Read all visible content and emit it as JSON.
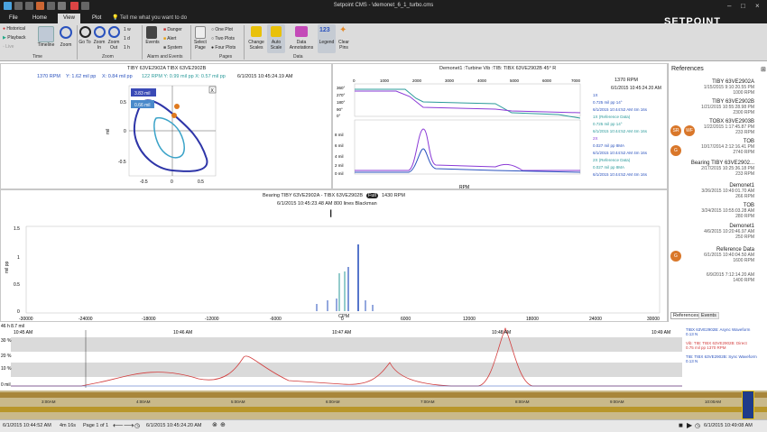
{
  "titlebar": {
    "title": "Setpoint CMS - \\demonet_6_1_turbo.cms"
  },
  "tabs": {
    "file": "File",
    "home": "Home",
    "view": "View",
    "plot": "Plot",
    "tellme": "Tell me what you want to do"
  },
  "brand": "SETPOINT",
  "ribbon": {
    "historical": "Historical",
    "playback": "Playback",
    "live": "Live",
    "timeline": "Timeline",
    "zoom": "Zoom",
    "goto": "Go To",
    "zoom_in": "Zoom In",
    "zoom_out": "Zoom Out",
    "w": "1 w",
    "d": "1 d",
    "h": "1 h",
    "events": "Events",
    "danger": "Danger",
    "alert": "Alert",
    "system": "System",
    "select_page": "Select Page",
    "one_plot": "One Plot",
    "two_plots": "Two Plots",
    "four_plots": "Four Plots",
    "change_scales": "Change Scales",
    "auto_scale": "Auto Scale",
    "data_annotations": "Data Annotations",
    "legend": "Legend",
    "clear_pins": "Clear Pins",
    "grp_time": "Time",
    "grp_zoom": "Zoom",
    "grp_alarm": "Alarm and Events",
    "grp_pages": "Pages",
    "grp_data": "Data"
  },
  "orbit": {
    "title": "TIBY 63VE2902A TIBX 63VE2902B",
    "rpm": "1370 RPM",
    "y": "Y: 1.62 mil pp",
    "x": "X: 0.84 mil pp",
    "readout2": "122 RPM  Y: 0.99 mil pp  X: 0.57 mil pp",
    "time": "6/1/2015 10:45:24.19 AM",
    "tag1": "3.83 mil",
    "tag2": "0.66 mil",
    "ylabel": "mil",
    "yticks": [
      "0.5",
      "0",
      "-0.5"
    ],
    "xticks": [
      "-0.5",
      "0",
      "0.5"
    ],
    "x_marker": "X"
  },
  "bode": {
    "title": "Demonet1 :Turbine Vib :TIB: TIBX 63VE2902B  45° R",
    "rpm": "1370  RPM",
    "time": "6/1/2015 10:45:24.20 AM",
    "xticks": [
      "0",
      "1000",
      "2000",
      "3000",
      "4000",
      "5000",
      "6000",
      "7000"
    ],
    "phase_ticks": [
      "360°",
      "270°",
      "180°",
      "90°",
      "0°"
    ],
    "amp_ticks": [
      "8 mil",
      "6 mil",
      "4 mil",
      "2 mil",
      "0 mil"
    ],
    "xlabel": "RPM",
    "legend": [
      {
        "label": "1X",
        "color": "#2a52be"
      },
      {
        "label": "0.725 mil pp 14°",
        "color": "#2a52be"
      },
      {
        "label": "6/1/2015 10:44:52 AM 4m 16s",
        "color": "#2a52be"
      },
      {
        "label": "1X (Reference Data)",
        "color": "#2a9a9a"
      },
      {
        "label": "0.725 mil pp 14°",
        "color": "#2a9a9a"
      },
      {
        "label": "6/1/2015 10:44:52 AM 4m 16s",
        "color": "#2a9a9a"
      },
      {
        "label": "2X",
        "color": "#8a3ad6"
      },
      {
        "label": "0.027 mil pp 8MA",
        "color": "#2a52be"
      },
      {
        "label": "6/1/2015 10:44:52 AM 4m 16s",
        "color": "#2a52be"
      },
      {
        "label": "2X (Reference Data)",
        "color": "#2a9a9a"
      },
      {
        "label": "0.027 mil pp 8MA",
        "color": "#2a9a9a"
      },
      {
        "label": "6/1/2015 10:44:52 AM 4m 16s",
        "color": "#2a52be"
      }
    ]
  },
  "spectrum": {
    "title": "Bearing TIBY 63VE2902A - TIBX 63VE2902B",
    "badge": "Full",
    "rpm": "1430 RPM",
    "subtitle": "6/1/2015 10:45:23.48 AM  800 lines  Blackman",
    "yticks": [
      "1.5",
      "1",
      "0.5",
      "0"
    ],
    "ylabel": "mil pp",
    "xticks": [
      "-30000",
      "-24000",
      "-18000",
      "-12000",
      "-6000",
      "0",
      "6000",
      "12000",
      "18000",
      "24000",
      "30000"
    ],
    "xlabel": "CPM"
  },
  "references": {
    "title": "References",
    "items": [
      {
        "name": "TIBY 63VE2902A",
        "date": "1/15/2015 9:10:20.55 PM",
        "rpm": "1000 RPM"
      },
      {
        "name": "TIBY 63VE2902B",
        "date": "1/21/2015 10:55:28.98 PM",
        "rpm": "2300 RPM"
      },
      {
        "name": "TOBX 63VE2903B",
        "date": "1/22/2015 1:17:45.87 PM",
        "rpm": "233 RPM"
      },
      {
        "name": "TOB",
        "date": "10/17/2014 2:12:16.41 PM",
        "rpm": "2740 RPM"
      },
      {
        "name": "Bearing TIBY 63VE2902...",
        "date": "2/17/2015 10:25:36.18 PM",
        "rpm": "233 RPM"
      },
      {
        "name": "Demonet1",
        "date": "3/26/2015 10:49:01.70 AM",
        "rpm": "266 RPM"
      },
      {
        "name": "TOB",
        "date": "3/24/2015 10:55:03.28 AM",
        "rpm": "280 RPM"
      },
      {
        "name": "Demonet1",
        "date": "4/6/2015 10:20:46.97 AM",
        "rpm": "250 RPM"
      },
      {
        "name": "Reference Data",
        "date": "6/1/2015 10:40:04.50 AM",
        "rpm": "1600 RPM"
      },
      {
        "name": "",
        "date": "6/9/2015 7:12:14.20 AM",
        "rpm": "1400 RPM"
      }
    ],
    "avatars": [
      "SR",
      "WF",
      "G",
      "G"
    ],
    "tab_refs": "References",
    "tab_events": "Events"
  },
  "trend": {
    "ylabel_top": "46 h 8.7 mil",
    "yticks": [
      "30 %",
      "20 %",
      "10 %",
      "0 mil"
    ],
    "times": [
      "10:45 AM",
      "10:46 AM",
      "10:47 AM",
      "10:48 AM",
      "10:49 AM"
    ],
    "legend": [
      {
        "label": "TIBX 63VE2902B: Async Waveform",
        "value": "0.13 N",
        "color": "#2a52be"
      },
      {
        "label": "Vib: TIB: TIBX 63VE2902B: Direct",
        "value": "0.75 mil pp  1370 RPM",
        "color": "#d23c3c"
      },
      {
        "label": "TIB: TIBX 63VE2902B: Sync Waveform",
        "value": "0.13 N",
        "color": "#2a52be"
      }
    ]
  },
  "timeline": {
    "ticks": [
      "3:00AM",
      "4:00AM",
      "5:00AM",
      "6:00AM",
      "7:00AM",
      "8:00AM",
      "9:00AM",
      "10:00AM"
    ]
  },
  "status": {
    "start": "6/1/2015 10:44:52 AM",
    "duration": "4m 16s",
    "page": "Page 1 of 1",
    "cursor": "6/1/2015 10:45:24.20 AM",
    "end": "6/1/2015 10:49:08 AM"
  }
}
